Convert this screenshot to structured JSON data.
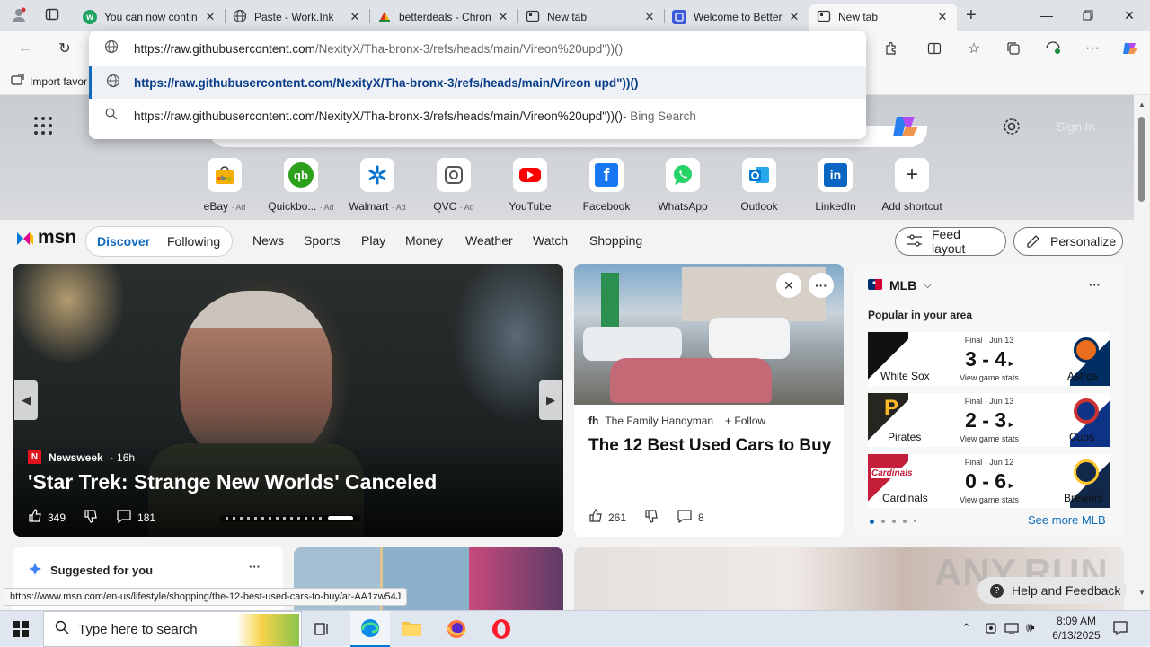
{
  "tabs": [
    {
      "title": "You can now contin",
      "icon": "wattpad-icon",
      "icon_color": "#1fa463"
    },
    {
      "title": "Paste - Work.Ink",
      "icon": "globe-icon",
      "icon_color": "#444444"
    },
    {
      "title": "betterdeals - Chron",
      "icon": "chrome-icon",
      "icon_color": "#d93025"
    },
    {
      "title": "New tab",
      "icon": "newtab-icon",
      "icon_color": "#444444"
    },
    {
      "title": "Welcome to Better",
      "icon": "betterdeals-icon",
      "icon_color": "#3b5bdb"
    },
    {
      "title": "New tab",
      "icon": "newtab-icon",
      "icon_color": "#444444",
      "active": true
    }
  ],
  "toolbar": {
    "back": "←",
    "refresh": "↻",
    "favorites_import": "Import favor"
  },
  "omnibox": {
    "input": "https://raw.githubusercontent.com/NexityX/Tha-bronx-3/refs/heads/main/Vireon%20upd\"))()",
    "input_host": "https://raw.githubusercontent.com",
    "input_path": "/NexityX/Tha-bronx-3/refs/heads/main/Vireon%20upd\"))()",
    "suggestion_url": "https://raw.githubusercontent.com/NexityX/Tha-bronx-3/refs/heads/main/Vireon upd\"))()",
    "search_text": "https://raw.githubusercontent.com/NexityX/Tha-bronx-3/refs/heads/main/Vireon%20upd\"))()",
    "search_suffix": " - Bing Search"
  },
  "ntp": {
    "signin": "Sign in"
  },
  "shortcuts": [
    {
      "label": "eBay",
      "ad": "· Ad",
      "color": "#e53238"
    },
    {
      "label": "Quickbo...",
      "ad": "· Ad",
      "color": "#2ca01c"
    },
    {
      "label": "Walmart",
      "ad": "· Ad",
      "color": "#0071ce"
    },
    {
      "label": "QVC",
      "ad": "· Ad",
      "color": "#555555"
    },
    {
      "label": "YouTube",
      "ad": "",
      "color": "#ff0000"
    },
    {
      "label": "Facebook",
      "ad": "",
      "color": "#1877f2"
    },
    {
      "label": "WhatsApp",
      "ad": "",
      "color": "#25d366"
    },
    {
      "label": "Outlook",
      "ad": "",
      "color": "#0078d4"
    },
    {
      "label": "LinkedIn",
      "ad": "",
      "color": "#0a66c2"
    },
    {
      "label": "Add shortcut",
      "ad": "",
      "color": "#ffffff"
    }
  ],
  "msn": {
    "logo": "msn",
    "tabs": {
      "discover": "Discover",
      "following": "Following"
    },
    "nav": [
      "News",
      "Sports",
      "Play",
      "Money",
      "Weather",
      "Watch",
      "Shopping"
    ],
    "feed_layout": "Feed layout",
    "personalize": "Personalize"
  },
  "hero": {
    "source": "Newsweek",
    "age": "· 16h",
    "title": "'Star Trek: Strange New Worlds' Canceled",
    "likes": "349",
    "comments": "181"
  },
  "story": {
    "source": "The Family Handyman",
    "follow": "Follow",
    "title": "The 12 Best Used Cars to Buy",
    "likes": "261",
    "comments": "8"
  },
  "mlb": {
    "title": "MLB",
    "subtitle": "Popular in your area",
    "see_more": "See more MLB",
    "games": [
      {
        "status": "Final · Jun 13",
        "score": "3 - 4",
        "stats": "View game stats",
        "away": "White Sox",
        "home": "Astros",
        "away_color": "#111111",
        "home_color": "#002d62",
        "home_accent": "#eb6e1f"
      },
      {
        "status": "Final · Jun 13",
        "score": "2 - 3",
        "stats": "View game stats",
        "away": "Pirates",
        "home": "Cubs",
        "away_color": "#27251f",
        "home_color": "#0e3386",
        "home_accent": "#cc3433"
      },
      {
        "status": "Final · Jun 12",
        "score": "0 - 6",
        "stats": "View game stats",
        "away": "Cardinals",
        "home": "Brewers",
        "away_color": "#c41e3a",
        "home_color": "#12284b",
        "home_accent": "#ffc52f"
      }
    ]
  },
  "suggested": {
    "title": "Suggested for you"
  },
  "status_url": "https://www.msn.com/en-us/lifestyle/shopping/the-12-best-used-cars-to-buy/ar-AA1zw54J",
  "help": "Help and Feedback",
  "watermark": "ANY.RUN",
  "taskbar": {
    "search": "Type here to search",
    "time": "8:09 AM",
    "date": "6/13/2025"
  }
}
